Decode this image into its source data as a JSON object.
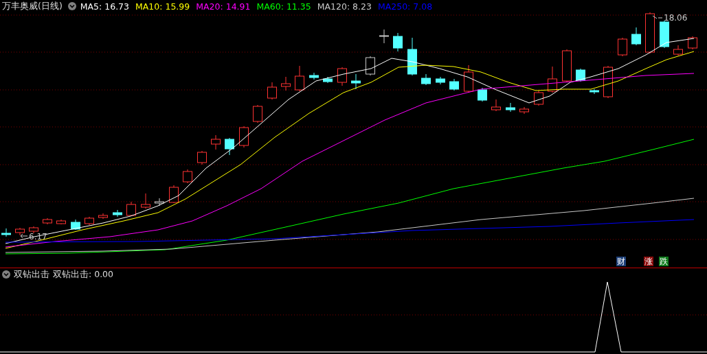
{
  "header": {
    "title": "万丰奥威(日线)",
    "indicators": [
      {
        "label": "MA5: 16.73",
        "color": "#ffffff"
      },
      {
        "label": "MA10: 15.99",
        "color": "#ffff00"
      },
      {
        "label": "MA20: 14.91",
        "color": "#ff00ff"
      },
      {
        "label": "MA60: 11.35",
        "color": "#00ff00"
      },
      {
        "label": "MA120: 8.23",
        "color": "#c8c8c8"
      },
      {
        "label": "MA250: 7.08",
        "color": "#0000ff"
      }
    ]
  },
  "price_chart": {
    "high_label": "18.06",
    "low_label": "6.17"
  },
  "markers": [
    {
      "text": "财",
      "color": "#1c3f78"
    },
    {
      "text": "涨",
      "color": "#8a0a0a"
    },
    {
      "text": "跌",
      "color": "#0d7a1a"
    }
  ],
  "sub_panel": {
    "title": "双钻出击",
    "reading": "双钻出击: 0.00"
  }
}
